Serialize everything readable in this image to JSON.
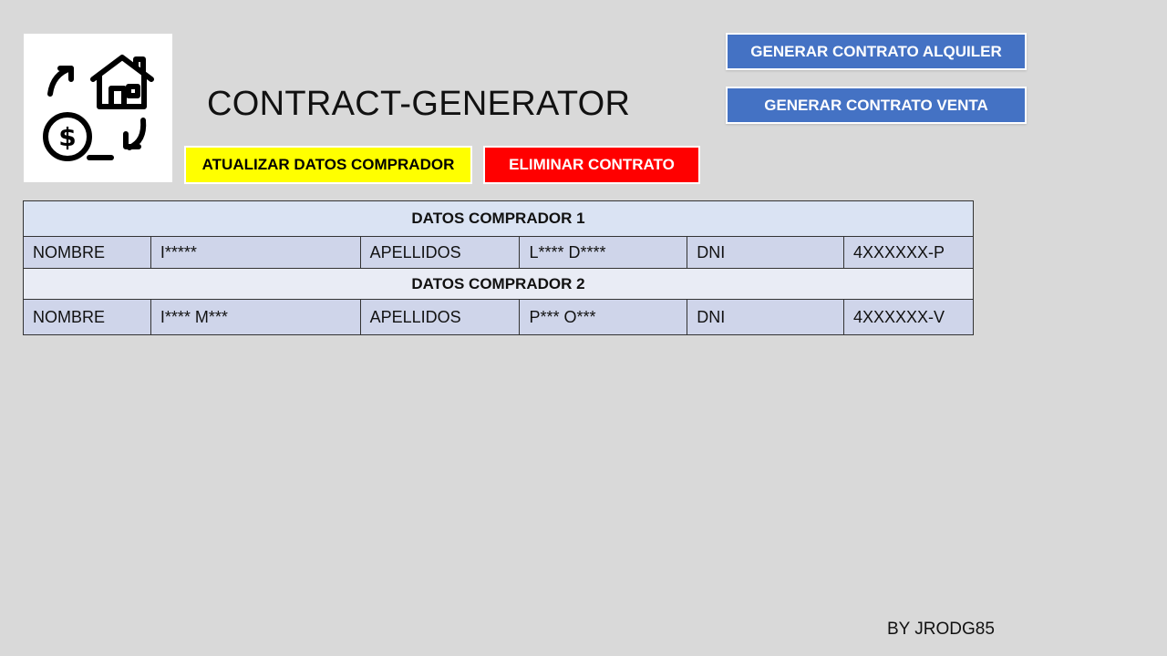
{
  "app": {
    "title": "CONTRACT-GENERATOR",
    "credit": "BY JRODG85"
  },
  "buttons": {
    "generar_alquiler": "GENERAR CONTRATO  ALQUILER",
    "generar_venta": "GENERAR CONTRATO  VENTA",
    "actualizar": "ATUALIZAR DATOS COMPRADOR",
    "eliminar": "ELIMINAR CONTRATO"
  },
  "colors": {
    "background": "#d9d9d9",
    "blue_button": "#4472c4",
    "yellow_button": "#ffff00",
    "red_button": "#ff0000",
    "section_header": "#dae3f3",
    "data_row": "#cfd5ea"
  },
  "icons": {
    "logo": "house-money-exchange-icon"
  },
  "buyers": [
    {
      "header": "DATOS COMPRADOR 1",
      "nombre_label": "NOMBRE",
      "nombre": "I*****",
      "apellidos_label": "APELLIDOS",
      "apellidos": "L**** D****",
      "dni_label": "DNI",
      "dni": "4XXXXXX-P"
    },
    {
      "header": "DATOS COMPRADOR 2",
      "nombre_label": "NOMBRE",
      "nombre": "I**** M***",
      "apellidos_label": "APELLIDOS",
      "apellidos": "P*** O***",
      "dni_label": "DNI",
      "dni": "4XXXXXX-V"
    }
  ]
}
